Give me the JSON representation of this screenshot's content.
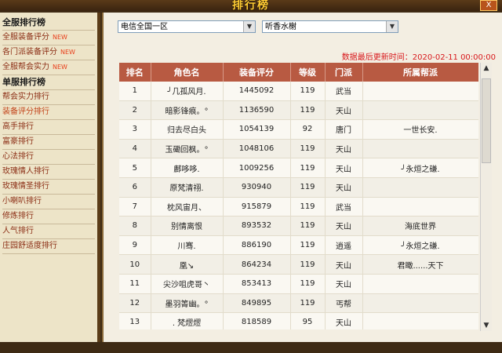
{
  "window": {
    "title": "排行榜",
    "close_label": "X"
  },
  "sidebar": {
    "items": [
      {
        "label": "全服排行榜",
        "header": true
      },
      {
        "label": "全服装备评分",
        "badge": "NEW"
      },
      {
        "label": "各门派装备评分",
        "badge": "NEW"
      },
      {
        "label": "全服帮会实力",
        "badge": "NEW"
      },
      {
        "label": "单服排行榜",
        "header": true
      },
      {
        "label": "帮会实力排行"
      },
      {
        "label": "装备评分排行",
        "selected": true
      },
      {
        "label": "高手排行"
      },
      {
        "label": "富豪排行"
      },
      {
        "label": "心法排行"
      },
      {
        "label": "玫瑰情人排行"
      },
      {
        "label": "玫瑰情圣排行"
      },
      {
        "label": "小喇叭排行"
      },
      {
        "label": "修炼排行"
      },
      {
        "label": "人气排行"
      },
      {
        "label": "庄园舒适度排行"
      }
    ]
  },
  "filters": {
    "server": "电信全国一区",
    "realm": "听香水榭"
  },
  "update_time": "数据最后更新时间：2020-02-11 00:00:00",
  "table": {
    "headers": [
      "排名",
      "角色名",
      "装备评分",
      "等级",
      "门派",
      "所属帮派"
    ],
    "rows": [
      [
        "1",
        "╯几孤风月.",
        "1445092",
        "119",
        "武当",
        ""
      ],
      [
        "2",
        "暗影锋痕。°",
        "1136590",
        "119",
        "天山",
        ""
      ],
      [
        "3",
        "归去尽白头",
        "1054139",
        "92",
        "唐门",
        "一世长安."
      ],
      [
        "4",
        "玉磡回枫。°",
        "1048106",
        "119",
        "天山",
        ""
      ],
      [
        "5",
        "鄜哆哆.",
        "1009256",
        "119",
        "天山",
        "╯永烜之磏."
      ],
      [
        "6",
        "原梵清祤.",
        "930940",
        "119",
        "天山",
        ""
      ],
      [
        "7",
        "枕风宙月、",
        "915879",
        "119",
        "武当",
        ""
      ],
      [
        "8",
        "别情离恨",
        "893532",
        "119",
        "天山",
        "海底世界"
      ],
      [
        "9",
        "川骞.",
        "886190",
        "119",
        "逍遥",
        "╯永烜之磏."
      ],
      [
        "10",
        "凰↘",
        "864234",
        "119",
        "天山",
        "君瞰......天下"
      ],
      [
        "11",
        "尖沙咀虎哥丶",
        "853413",
        "119",
        "天山",
        ""
      ],
      [
        "12",
        "墨羽箐幽。°",
        "849895",
        "119",
        "丐帮",
        ""
      ],
      [
        "13",
        ". 梵熤熤",
        "818589",
        "95",
        "天山",
        ""
      ]
    ]
  },
  "colors": {
    "accent": "#b85a42",
    "sidebar_link": "#8b2d14",
    "new_badge": "#e8401c",
    "update_text": "#d8181c"
  }
}
